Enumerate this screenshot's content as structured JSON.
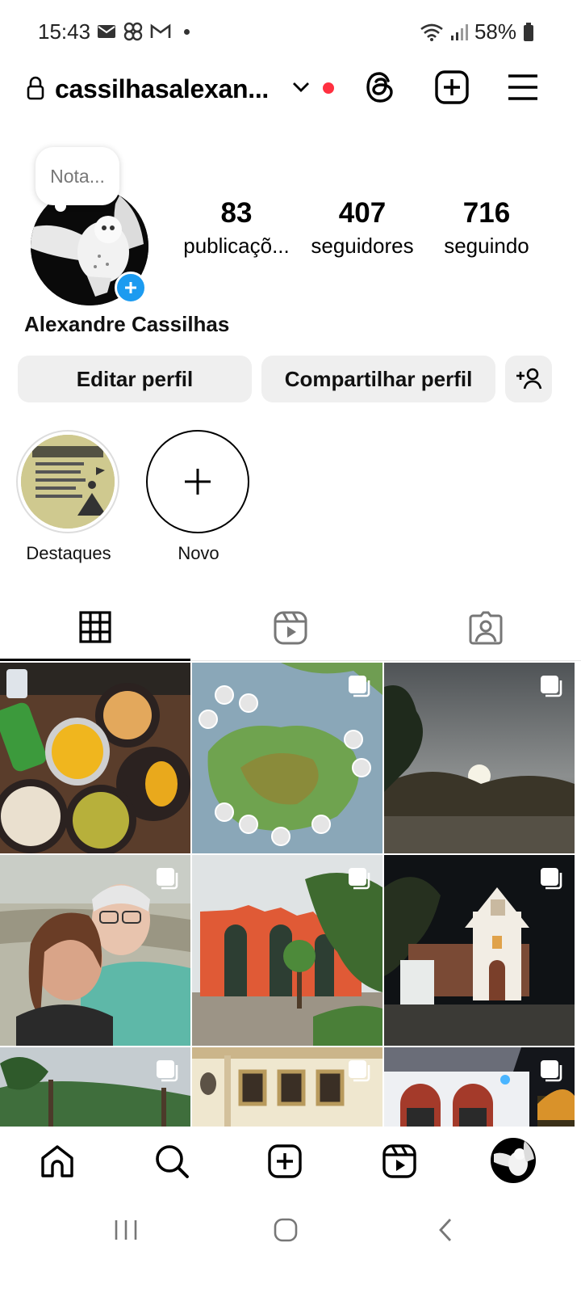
{
  "status_bar": {
    "time": "15:43",
    "battery_text": "58%"
  },
  "header": {
    "username": "cassilhasalexan...",
    "icons": [
      "lock-icon",
      "chevron-down-icon",
      "threads-icon",
      "create-icon",
      "menu-icon"
    ]
  },
  "profile": {
    "note": "Nota...",
    "full_name": "Alexandre Cassilhas",
    "stats": [
      {
        "num": "83",
        "label": "publicaçõ..."
      },
      {
        "num": "407",
        "label": "seguidores"
      },
      {
        "num": "716",
        "label": "seguindo"
      }
    ]
  },
  "actions": {
    "edit": "Editar perfil",
    "share": "Compartilhar perfil"
  },
  "highlights": [
    {
      "label": "Destaques"
    },
    {
      "label": "Novo"
    }
  ],
  "tabs": [
    "grid-icon",
    "reels-icon",
    "tagged-icon"
  ],
  "grid": {
    "posts": [
      {
        "kind": "food",
        "multi": false
      },
      {
        "kind": "map",
        "multi": true
      },
      {
        "kind": "sunset",
        "multi": true
      },
      {
        "kind": "selfie",
        "multi": true
      },
      {
        "kind": "orange-building",
        "multi": true
      },
      {
        "kind": "church-night",
        "multi": true
      },
      {
        "kind": "palms",
        "multi": true
      },
      {
        "kind": "facade",
        "multi": true
      },
      {
        "kind": "white-house-night",
        "multi": true
      }
    ]
  },
  "bottom_nav": [
    "home-icon",
    "search-icon",
    "create-icon",
    "reels-icon",
    "profile-avatar"
  ],
  "colors": {
    "accent_blue": "#1c9bf0",
    "notification_red": "#ff3040",
    "button_bg": "#efefef"
  }
}
